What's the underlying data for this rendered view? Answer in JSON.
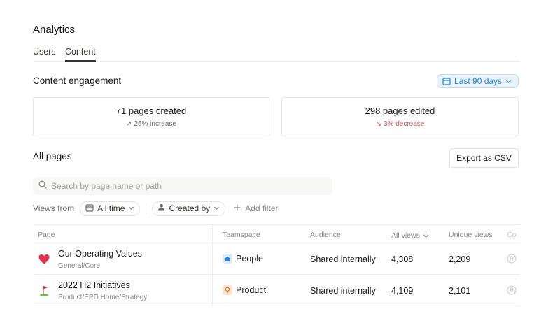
{
  "page": {
    "title": "Analytics"
  },
  "tabs": [
    {
      "label": "Users",
      "active": false
    },
    {
      "label": "Content",
      "active": true
    }
  ],
  "engagement": {
    "title": "Content engagement",
    "range_label": "Last 90 days",
    "cards": [
      {
        "metric": "71 pages created",
        "delta_arrow": "↗",
        "delta": "26% increase",
        "trend": "up"
      },
      {
        "metric": "298 pages edited",
        "delta_arrow": "↘",
        "delta": "3% decrease",
        "trend": "down"
      }
    ]
  },
  "all_pages": {
    "title": "All pages",
    "export_label": "Export as CSV",
    "search_placeholder": "Search by page name or path",
    "views_from_label": "Views from",
    "filter_time": "All time",
    "filter_creator": "Created by",
    "add_filter": "Add filter"
  },
  "table": {
    "headers": {
      "page": "Page",
      "teamspace": "Teamspace",
      "audience": "Audience",
      "all_views": "All views",
      "unique_views": "Unique views",
      "extra": "Co"
    },
    "rows": [
      {
        "name": "Our Operating Values",
        "path": "General/Core",
        "emoji": "heart-icon",
        "teamspace": "People",
        "teamspace_icon": "home-icon",
        "audience": "Shared internally",
        "all_views": "4,308",
        "unique_views": "2,209"
      },
      {
        "name": "2022 H2 Initiatives",
        "path": "Product/EPD Home/Strategy",
        "emoji": "golf-flag-icon",
        "teamspace": "Product",
        "teamspace_icon": "lightbulb-icon",
        "audience": "Shared internally",
        "all_views": "4,109",
        "unique_views": "2,101"
      }
    ]
  },
  "colors": {
    "accent": "#2383e2",
    "decrease": "#cf5555",
    "people_team_bg": "#dbeafa",
    "product_team_bg": "#fbe4d2"
  }
}
